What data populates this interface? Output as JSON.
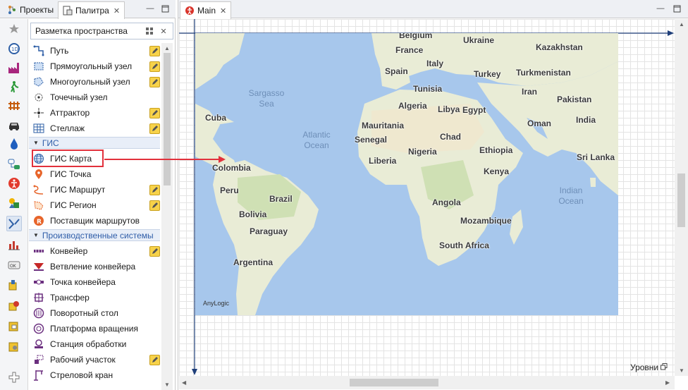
{
  "left_tabs": {
    "projects": "Проекты",
    "palette": "Палитра"
  },
  "palette": {
    "header": "Разметка пространства",
    "items_space": [
      {
        "label": "Путь",
        "icon": "path-icon",
        "editable": true
      },
      {
        "label": "Прямоугольный узел",
        "icon": "rect-node-icon",
        "editable": true
      },
      {
        "label": "Многоугольный узел",
        "icon": "polygon-node-icon",
        "editable": true
      },
      {
        "label": "Точечный узел",
        "icon": "point-node-icon",
        "editable": false
      },
      {
        "label": "Аттрактор",
        "icon": "attractor-icon",
        "editable": true
      },
      {
        "label": "Стеллаж",
        "icon": "rack-icon",
        "editable": true
      }
    ],
    "section_gis": "ГИС",
    "items_gis": [
      {
        "label": "ГИС Карта",
        "icon": "globe-icon",
        "editable": false
      },
      {
        "label": "ГИС Точка",
        "icon": "pin-icon",
        "editable": false
      },
      {
        "label": "ГИС Маршрут",
        "icon": "route-icon",
        "editable": true
      },
      {
        "label": "ГИС Регион",
        "icon": "region-icon",
        "editable": true
      },
      {
        "label": "Поставщик маршрутов",
        "icon": "route-provider-icon",
        "editable": false
      }
    ],
    "section_production": "Производственные системы",
    "items_production": [
      {
        "label": "Конвейер",
        "icon": "conveyor-icon",
        "editable": true
      },
      {
        "label": "Ветвление конвейера",
        "icon": "conveyor-branch-icon",
        "editable": false
      },
      {
        "label": "Точка конвейера",
        "icon": "conveyor-point-icon",
        "editable": false
      },
      {
        "label": "Трансфер",
        "icon": "transfer-icon",
        "editable": false
      },
      {
        "label": "Поворотный стол",
        "icon": "turntable-icon",
        "editable": false
      },
      {
        "label": "Платформа вращения",
        "icon": "rotation-platform-icon",
        "editable": false
      },
      {
        "label": "Станция обработки",
        "icon": "station-icon",
        "editable": false
      },
      {
        "label": "Рабочий участок",
        "icon": "work-area-icon",
        "editable": true
      },
      {
        "label": "Стреловой кран",
        "icon": "jib-crane-icon",
        "editable": false
      }
    ]
  },
  "editor": {
    "tab_label": "Main",
    "levels_label": "Уровни",
    "map_credit": "AnyLogic"
  },
  "map": {
    "countries": [
      "Belgium",
      "Ukraine",
      "Kazakhstan",
      "France",
      "Italy",
      "Spain",
      "Turkey",
      "Turkmenistan",
      "Tunisia",
      "Iran",
      "Algeria",
      "Libya",
      "Egypt",
      "Pakistan",
      "Cuba",
      "Mauritania",
      "India",
      "Oman",
      "Chad",
      "Senegal",
      "Nigeria",
      "Ethiopia",
      "Sri Lanka",
      "Colombia",
      "Liberia",
      "Kenya",
      "Peru",
      "Brazil",
      "Bolivia",
      "Angola",
      "Paraguay",
      "Mozambique",
      "South Africa",
      "Argentina"
    ],
    "oceans": [
      "Sargasso Sea",
      "Atlantic Ocean",
      "Indian Ocean"
    ]
  },
  "colors": {
    "water": "#a7c7ec",
    "land": "#e9ecd6",
    "highlight": "#e2313c",
    "section_text": "#2f5da8"
  }
}
